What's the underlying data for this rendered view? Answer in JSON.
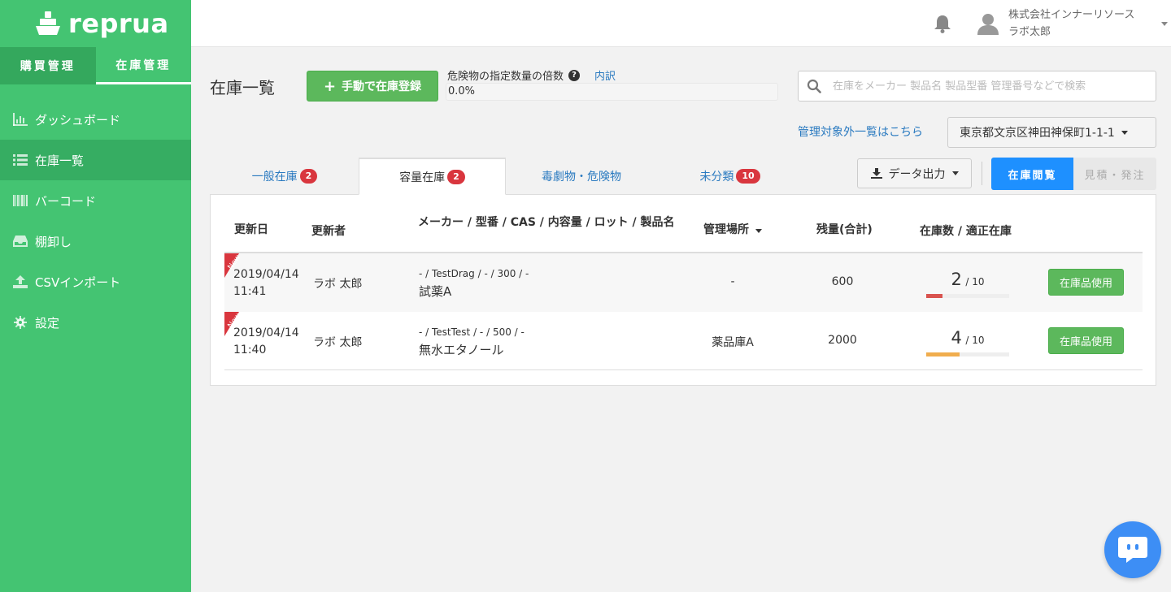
{
  "app": {
    "logo_text": "reprua"
  },
  "sidebar": {
    "top_tabs": [
      {
        "label": "購買管理"
      },
      {
        "label": "在庫管理"
      }
    ],
    "items": [
      {
        "label": "ダッシュボード",
        "icon": "bar-chart-icon"
      },
      {
        "label": "在庫一覧",
        "icon": "list-icon"
      },
      {
        "label": "バーコード",
        "icon": "barcode-icon"
      },
      {
        "label": "棚卸し",
        "icon": "inbox-icon"
      },
      {
        "label": "CSVインポート",
        "icon": "upload-icon"
      },
      {
        "label": "設定",
        "icon": "gear-icon"
      }
    ]
  },
  "header": {
    "company": "株式会社インナーリソース",
    "user": "ラボ太郎"
  },
  "page": {
    "title": "在庫一覧",
    "register_button": "手動で在庫登録",
    "hazard_label": "危険物の指定数量の倍数",
    "hazard_detail_link": "内訳",
    "hazard_value": "0.0%",
    "search_placeholder": "在庫をメーカー 製品名 製品型番 管理番号などで検索",
    "excluded_link": "管理対象外一覧はこちら",
    "location": "東京都文京区神田神保町1-1-1"
  },
  "tabs": [
    {
      "label": "一般在庫",
      "badge": "2"
    },
    {
      "label": "容量在庫",
      "badge": "2"
    },
    {
      "label": "毒劇物・危険物"
    },
    {
      "label": "未分類",
      "badge": "10"
    }
  ],
  "toolbar": {
    "export_label": "データ出力",
    "view_label": "在庫閲覧",
    "order_label": "見積・発注"
  },
  "table": {
    "headers": {
      "date": "更新日",
      "updater": "更新者",
      "maker": "メーカー / 型番 / CAS / 内容量 / ロット / 製品名",
      "place": "管理場所",
      "remain": "残量(合計)",
      "stock": "在庫数 / 適正在庫"
    },
    "new_label": "New",
    "rows": [
      {
        "date": "2019/04/14",
        "time": "11:41",
        "updater": "ラボ 太郎",
        "maker_sub": "- / TestDrag / - / 300 / -",
        "name": "試薬A",
        "place": "-",
        "remain": "600",
        "stock": "2",
        "proper": "/ 10",
        "stock_fraction": 0.2,
        "bar_color": "#d9534f",
        "use_button": "在庫品使用"
      },
      {
        "date": "2019/04/14",
        "time": "11:40",
        "updater": "ラボ 太郎",
        "maker_sub": "- / TestTest / - / 500 / -",
        "name": "無水エタノール",
        "place": "薬品庫A",
        "remain": "2000",
        "stock": "4",
        "proper": "/ 10",
        "stock_fraction": 0.4,
        "bar_color": "#f0ad4e",
        "use_button": "在庫品使用"
      }
    ]
  },
  "colors": {
    "sidebar": "#44c472",
    "primary_green": "#5cb85c",
    "link": "#2a7ac0",
    "badge": "#d9363e",
    "active_blue": "#1e90ff"
  }
}
